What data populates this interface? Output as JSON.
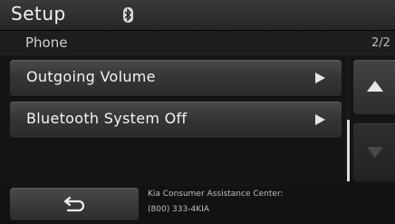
{
  "header": {
    "title": "Setup",
    "status_icon": "bluetooth-icon"
  },
  "subheader": {
    "title": "Phone",
    "page_indicator": "2/2"
  },
  "menu": {
    "items": [
      {
        "label": "Outgoing Volume",
        "icon": "right-arrow-icon"
      },
      {
        "label": "Bluetooth System Off",
        "icon": "right-arrow-icon"
      }
    ]
  },
  "scroll": {
    "up_icon": "up-triangle-icon",
    "down_icon": "down-triangle-icon",
    "down_enabled": false,
    "position_fraction": 1.0
  },
  "footer": {
    "back_icon": "back-arrow-icon",
    "assistance_label": "Kia Consumer Assistance Center:",
    "assistance_phone": "(800) 333-4KIA"
  }
}
